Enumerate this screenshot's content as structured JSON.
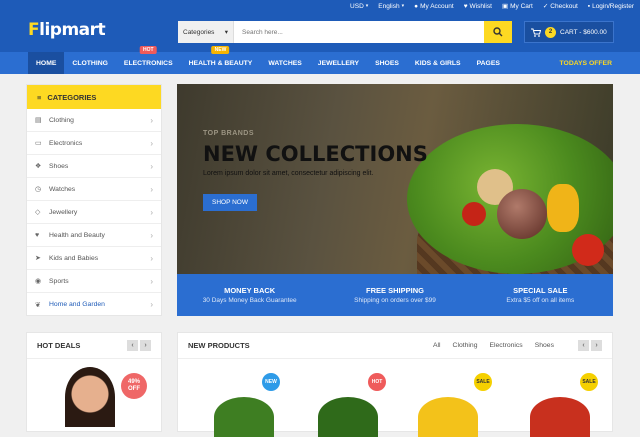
{
  "topbar": {
    "currency": "USD",
    "language": "English",
    "my_account": "My Account",
    "wishlist": "Wishlist",
    "my_cart": "My Cart",
    "checkout": "Checkout",
    "login": "Login/Register"
  },
  "header": {
    "logo": "lipmart",
    "logo_f": "F",
    "search_category": "Categories",
    "search_placeholder": "Search here...",
    "cart_count": "2",
    "cart_label": "CART - $600.00"
  },
  "nav": {
    "items": [
      "HOME",
      "CLOTHING",
      "ELECTRONICS",
      "HEALTH & BEAUTY",
      "WATCHES",
      "JEWELLERY",
      "SHOES",
      "KIDS & GIRLS",
      "PAGES"
    ],
    "hot_tag": "HOT",
    "new_tag": "NEW",
    "today": "TODAYS OFFER"
  },
  "categories": {
    "title": "CATEGORIES",
    "items": [
      "Clothing",
      "Electronics",
      "Shoes",
      "Watches",
      "Jewellery",
      "Health and Beauty",
      "Kids and Babies",
      "Sports",
      "Home and Garden"
    ]
  },
  "hero": {
    "subtitle": "TOP BRANDS",
    "title": "NEW COLLECTIONS",
    "desc": "Lorem ipsum dolor sit amet, consectetur adipiscing elit.",
    "button": "SHOP NOW"
  },
  "features": [
    {
      "title": "MONEY BACK",
      "sub": "30 Days Money Back Guarantee"
    },
    {
      "title": "FREE SHIPPING",
      "sub": "Shipping on orders over $99"
    },
    {
      "title": "SPECIAL SALE",
      "sub": "Extra $5 off on all items"
    }
  ],
  "hot_deals": {
    "title": "HOT DEALS",
    "discount": "49%",
    "off": "OFF"
  },
  "new_products": {
    "title": "NEW PRODUCTS",
    "tabs": [
      "All",
      "Clothing",
      "Electronics",
      "Shoes"
    ],
    "badges": [
      "NEW",
      "HOT",
      "SALE",
      "SALE"
    ]
  }
}
